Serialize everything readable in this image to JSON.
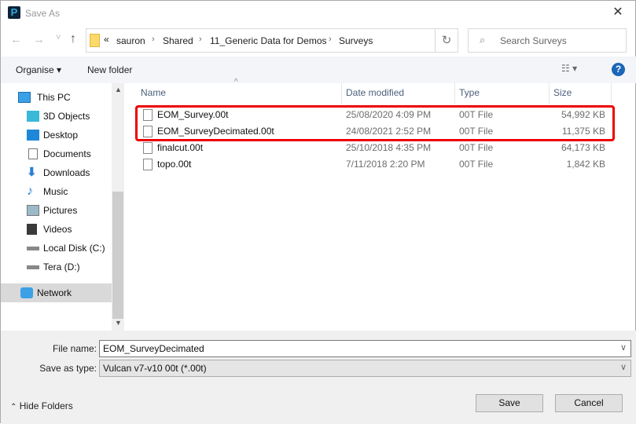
{
  "window": {
    "title": "Save As",
    "close": "✕"
  },
  "nav": {
    "back": "←",
    "forward": "→",
    "recent": "˅",
    "up": "↑",
    "refresh": "↻"
  },
  "address": {
    "overflow": "«",
    "crumbs": [
      "sauron",
      "Shared",
      "11_Generic Data for Demos",
      "Surveys"
    ]
  },
  "search": {
    "placeholder": "Search Surveys"
  },
  "toolbar": {
    "organise": "Organise ▾",
    "new_folder": "New folder",
    "help": "?"
  },
  "sidebar": {
    "items": [
      {
        "label": "This PC",
        "icon": "computer-icon"
      },
      {
        "label": "3D Objects",
        "icon": "cube-icon"
      },
      {
        "label": "Desktop",
        "icon": "desktop-icon"
      },
      {
        "label": "Documents",
        "icon": "document-icon"
      },
      {
        "label": "Downloads",
        "icon": "download-icon"
      },
      {
        "label": "Music",
        "icon": "music-icon"
      },
      {
        "label": "Pictures",
        "icon": "pictures-icon"
      },
      {
        "label": "Videos",
        "icon": "videos-icon"
      },
      {
        "label": "Local Disk (C:)",
        "icon": "drive-icon"
      },
      {
        "label": "Tera (D:)",
        "icon": "drive-icon"
      },
      {
        "label": "Network",
        "icon": "network-icon"
      }
    ]
  },
  "columns": {
    "name": "Name",
    "date": "Date modified",
    "type": "Type",
    "size": "Size"
  },
  "files": [
    {
      "name": "EOM_Survey.00t",
      "date": "25/08/2020 4:09 PM",
      "type": "00T File",
      "size": "54,992 KB"
    },
    {
      "name": "EOM_SurveyDecimated.00t",
      "date": "24/08/2021 2:52 PM",
      "type": "00T File",
      "size": "11,375 KB"
    },
    {
      "name": "finalcut.00t",
      "date": "25/10/2018 4:35 PM",
      "type": "00T File",
      "size": "64,173 KB"
    },
    {
      "name": "topo.00t",
      "date": "7/11/2018 2:20 PM",
      "type": "00T File",
      "size": "1,842 KB"
    }
  ],
  "bottom": {
    "file_name_label": "File name:",
    "file_name": "EOM_SurveyDecimated",
    "type_label": "Save as type:",
    "type_value": "Vulcan v7-v10 00t (*.00t)",
    "hide_folders": "Hide Folders",
    "save": "Save",
    "cancel": "Cancel"
  },
  "colors": {
    "highlight": "#e00000",
    "help": "#1a66b8"
  }
}
